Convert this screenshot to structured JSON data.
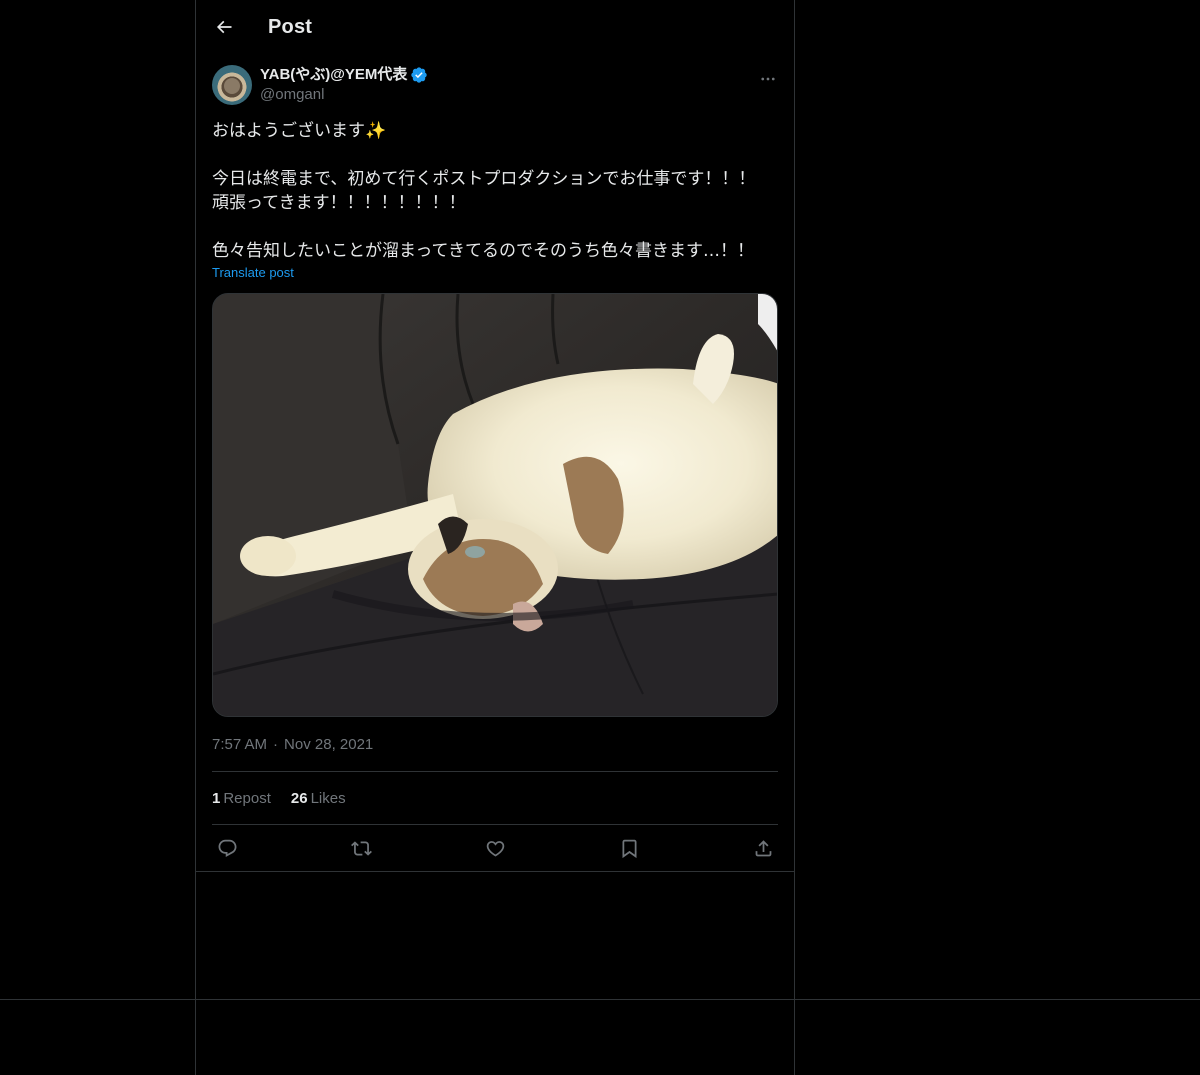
{
  "header": {
    "title": "Post"
  },
  "author": {
    "name": "YAB(やぶ)@YEM代表",
    "handle": "@omganl",
    "verified": true
  },
  "post": {
    "text": "おはようございます✨\n\n今日は終電まで、初めて行くポストプロダクションでお仕事です！！！\n頑張ってきます！！！！！！！！\n\n色々告知したいことが溜まってきてるのでそのうち色々書きます…！！",
    "translate_label": "Translate post",
    "time": "7:57 AM",
    "separator": "·",
    "date": "Nov 28, 2021"
  },
  "stats": {
    "reposts_count": "1",
    "reposts_label": "Repost",
    "likes_count": "26",
    "likes_label": "Likes"
  },
  "actions": {
    "icons": [
      "reply-icon",
      "repost-icon",
      "like-icon",
      "bookmark-icon",
      "share-icon"
    ]
  },
  "colors": {
    "background": "#000000",
    "text": "#e7e9ea",
    "muted": "#71767b",
    "border": "#2f3336",
    "accent": "#1d9bf0"
  }
}
